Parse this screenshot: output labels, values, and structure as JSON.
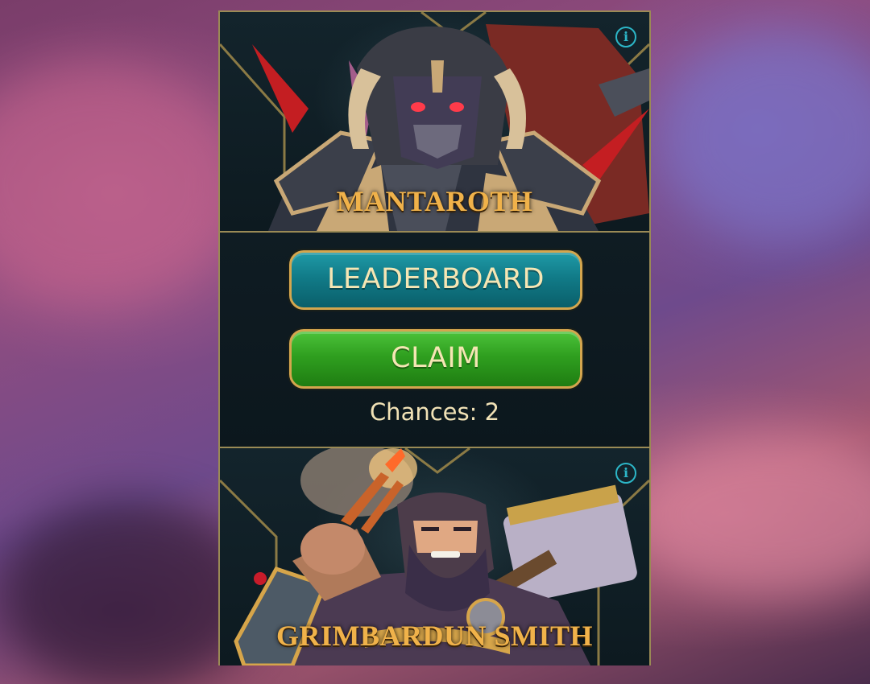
{
  "colors": {
    "accent_gold": "#f0b24a",
    "border_gold": "#9a8a55",
    "leaderboard_teal": "#117b88",
    "claim_green": "#2f9f1f",
    "info_cyan": "#2cb6c7"
  },
  "top_hero": {
    "name": "MANTAROTH",
    "info_icon": "info-icon",
    "info_glyph": "i"
  },
  "actions": {
    "leaderboard_label": "LEADERBOARD",
    "claim_label": "CLAIM",
    "chances_text": "Chances: 2"
  },
  "bottom_hero": {
    "name": "GRIMBARDUN SMITH",
    "info_icon": "info-icon",
    "info_glyph": "i"
  }
}
